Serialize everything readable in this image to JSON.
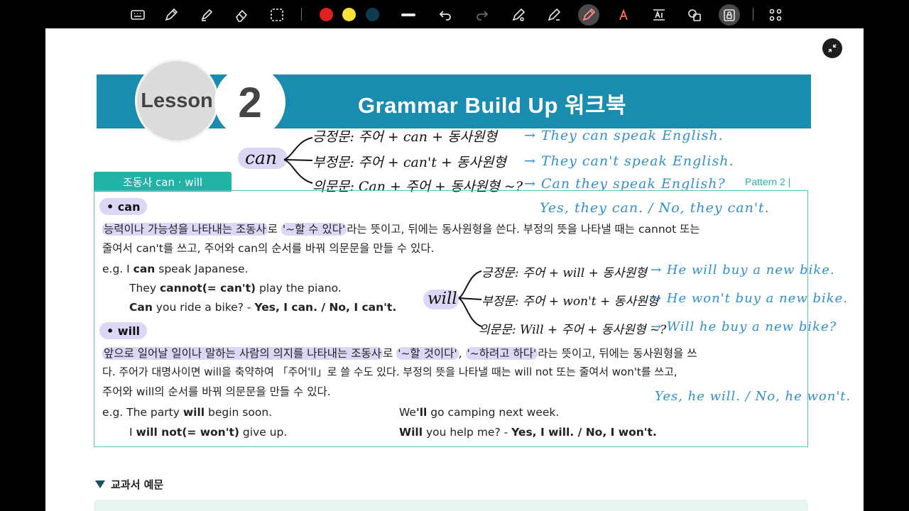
{
  "colors": {
    "banner": "#1a8cb0",
    "teal": "#22b3a6",
    "highlight": "#ddd6f5",
    "handwriting_blue": "#2f8fcf"
  },
  "toolbar": {
    "icons": [
      "keyboard-icon",
      "pen-icon",
      "highlighter-icon",
      "eraser-icon",
      "lasso-select-icon",
      "color-red",
      "color-yellow",
      "color-navy",
      "stroke-width-icon",
      "undo-icon",
      "redo-icon",
      "pen-settings-icon",
      "shape-pen-icon",
      "laser-pen-icon",
      "text-color-icon",
      "text-box-icon",
      "shapes-icon",
      "lock-screen-icon",
      "apps-grid-icon"
    ]
  },
  "banner": {
    "lesson_label": "Lesson",
    "lesson_number": "2",
    "title": "Grammar Build Up 워크북"
  },
  "section": {
    "tab_label": "조동사 can · will",
    "pattern_label": "Pattern 2 |"
  },
  "can_section": {
    "bullet": "can",
    "desc_hl1": "능력이나 가능성을 나타내는 조동사",
    "desc_mid": "로 ",
    "desc_hl2": "'~할 수 있다'",
    "desc_rest": "라는 뜻이고, 뒤에는 동사원형을 쓴다. 부정의 뜻을 나타낼 때는 cannot 또는",
    "desc_line2": "줄여서 can't를 쓰고, 주어와 can의 순서를 바꿔 의문문을 만들 수 있다.",
    "ex1_prefix": "e.g. I ",
    "ex1_bold": "can",
    "ex1_rest": " speak Japanese.",
    "ex2_pre": "They ",
    "ex2_bold": "cannot(= can't)",
    "ex2_rest": " play the piano.",
    "ex3_bold1": "Can",
    "ex3_mid": " you ride a bike? - ",
    "ex3_bold2": "Yes, I can. / No, I can't."
  },
  "will_section": {
    "bullet": "will",
    "desc_hl1": "앞으로 일어날 일이나 말하는 사람의 의지를 나타내는 조동사",
    "desc_mid1": "로 ",
    "desc_hl2": "'~할 것이다'",
    "desc_mid2": ", ",
    "desc_hl3": "'~하려고 하다'",
    "desc_rest": "라는 뜻이고, 뒤에는 동사원형을 쓰",
    "desc_line2": "다. 주어가 대명사이면 will을 축약하여 「주어'll」로 쓸 수도 있다. 부정의 뜻을 나타낼 때는 will not 또는 줄여서 won't를 쓰고,",
    "desc_line3": "주어와 will의 순서를 바꿔 의문문을 만들 수 있다.",
    "ex1_prefix": "e.g. The party ",
    "ex1_bold": "will",
    "ex1_rest": " begin soon.",
    "ex2_pre": "I ",
    "ex2_bold": "will not(= won't)",
    "ex2_rest": " give up.",
    "ex3_pre": "We",
    "ex3_bold": "'ll",
    "ex3_rest": " go camping next week.",
    "ex4_bold1": "Will",
    "ex4_mid": " you help me? - ",
    "ex4_bold2": "Yes, I will. / No, I won't."
  },
  "handwriting": {
    "can_word": "can",
    "can_rule1": "긍정문: 주어 + can + 동사원형",
    "can_rule2": "부정문: 주어 + can't + 동사원형",
    "can_rule3": "의문문: Can + 주어 + 동사원형 ~?",
    "can_ex1": "→ They can speak English.",
    "can_ex2": "→ They can't speak English.",
    "can_ex3": "→ Can they speak English?",
    "can_answer": "Yes, they can. / No, they can't.",
    "will_word": "will",
    "will_rule1": "긍정문: 주어 + will + 동사원형",
    "will_rule2": "부정문: 주어 + won't + 동사원형",
    "will_rule3": "의문문: Will + 주어 + 동사원형 ~?",
    "will_ex1": "→ He will buy a new bike.",
    "will_ex2": "→ He won't buy a new bike.",
    "will_ex3": "→ Will he buy a new bike?",
    "will_answer": "Yes, he will. / No, he won't."
  },
  "bottom": {
    "heading": "교과서 예문"
  }
}
